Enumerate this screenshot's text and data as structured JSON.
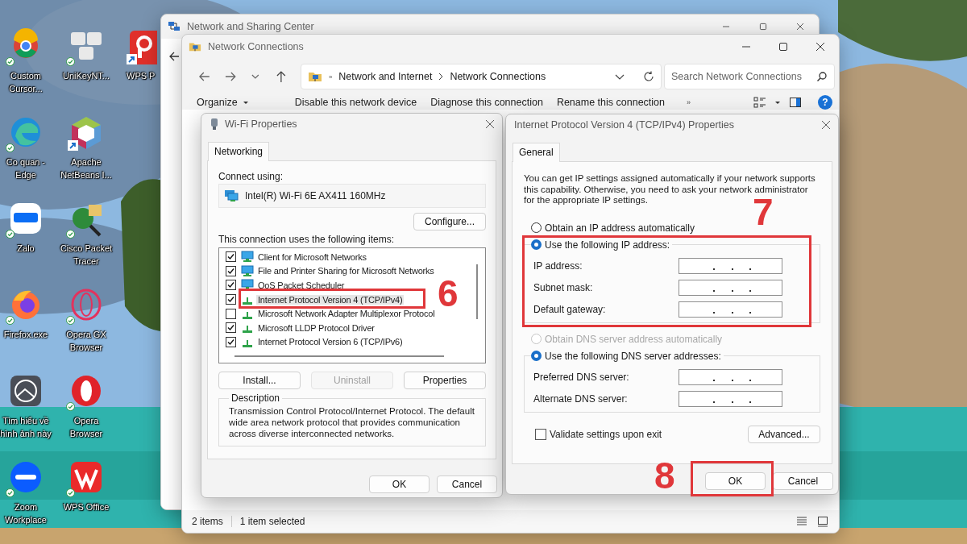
{
  "desktop": {
    "columns": [
      [
        {
          "label": "Custom Cursor...",
          "synced": true,
          "shortcut": false
        },
        {
          "label": "Co quan - Edge",
          "synced": true,
          "shortcut": false
        },
        {
          "label": "Zalo",
          "synced": true,
          "shortcut": false
        },
        {
          "label": "Firefox.exe",
          "synced": true,
          "shortcut": false
        },
        {
          "label": "Tìm hiểu về hình ảnh này",
          "synced": false,
          "shortcut": false
        },
        {
          "label": "Zoom Workplace",
          "synced": true,
          "shortcut": false
        }
      ],
      [
        {
          "label": "UniKeyNT...",
          "synced": true,
          "shortcut": false
        },
        {
          "label": "Apache NetBeans I...",
          "synced": false,
          "shortcut": true
        },
        {
          "label": "Cisco Packet Tracer",
          "synced": true,
          "shortcut": false
        },
        {
          "label": "Opera GX Browser",
          "synced": true,
          "shortcut": false
        },
        {
          "label": "Opera Browser",
          "synced": true,
          "shortcut": false
        },
        {
          "label": "WPS Office",
          "synced": true,
          "shortcut": false
        }
      ],
      [
        {
          "label": "WPS P",
          "synced": false,
          "shortcut": true
        }
      ]
    ]
  },
  "sharing_center": {
    "title": "Network and Sharing Center"
  },
  "connections": {
    "title": "Network Connections",
    "address": {
      "overflow": "»",
      "segments": [
        "Network and Internet",
        "Network Connections"
      ]
    },
    "search": {
      "placeholder": "Search Network Connections"
    },
    "toolbar": [
      "Organize",
      "Disable this network device",
      "Diagnose this connection",
      "Rename this connection"
    ],
    "toolbar_overflow": "»",
    "help": "?",
    "status_bar": [
      "2 items",
      "1 item selected"
    ]
  },
  "wifi_dialog": {
    "title": "Wi-Fi Properties",
    "tabs": [
      {
        "label": "Networking",
        "selected": true
      }
    ],
    "connect_label": "Connect using:",
    "adapter": "Intel(R) Wi-Fi 6E AX411 160MHz",
    "configure": "Configure...",
    "items_label": "This connection uses the following items:",
    "items": [
      {
        "label": "Client for Microsoft Networks",
        "kind": "service",
        "checked": true,
        "selected": false
      },
      {
        "label": "File and Printer Sharing for Microsoft Networks",
        "kind": "service",
        "checked": true,
        "selected": false
      },
      {
        "label": "QoS Packet Scheduler",
        "kind": "service",
        "checked": true,
        "selected": false
      },
      {
        "label": "Internet Protocol Version 4 (TCP/IPv4)",
        "kind": "protocol",
        "checked": true,
        "selected": true
      },
      {
        "label": "Microsoft Network Adapter Multiplexor Protocol",
        "kind": "protocol",
        "checked": false,
        "selected": false
      },
      {
        "label": "Microsoft LLDP Protocol Driver",
        "kind": "protocol",
        "checked": true,
        "selected": false
      },
      {
        "label": "Internet Protocol Version 6 (TCP/IPv6)",
        "kind": "protocol",
        "checked": true,
        "selected": false
      }
    ],
    "buttons": [
      {
        "label": "Install...",
        "disabled": false
      },
      {
        "label": "Uninstall",
        "disabled": true
      },
      {
        "label": "Properties",
        "disabled": false
      }
    ],
    "description": {
      "legend": "Description",
      "text": "Transmission Control Protocol/Internet Protocol. The default wide area network protocol that provides communication across diverse interconnected networks."
    },
    "footer": [
      "OK",
      "Cancel"
    ]
  },
  "ipv4_dialog": {
    "title": "Internet Protocol Version 4 (TCP/IPv4) Properties",
    "tabs": [
      {
        "label": "General",
        "selected": true
      }
    ],
    "intro": "You can get IP settings assigned automatically if your network supports this capability. Otherwise, you need to ask your network administrator for the appropriate IP settings.",
    "ip": {
      "auto": {
        "label": "Obtain an IP address automatically",
        "selected": false,
        "disabled": false
      },
      "manual": {
        "label": "Use the following IP address:",
        "selected": true,
        "disabled": false
      },
      "fields": [
        "IP address:",
        "Subnet mask:",
        "Default gateway:"
      ]
    },
    "dns": {
      "auto": {
        "label": "Obtain DNS server address automatically",
        "selected": false,
        "disabled": true
      },
      "manual": {
        "label": "Use the following DNS server addresses:",
        "selected": true,
        "disabled": false
      },
      "fields": [
        "Preferred DNS server:",
        "Alternate DNS server:"
      ]
    },
    "validate": {
      "label": "Validate settings upon exit",
      "checked": false
    },
    "advanced": "Advanced...",
    "footer": [
      "OK",
      "Cancel"
    ]
  },
  "annotations": [
    {
      "label": "6"
    },
    {
      "label": "7"
    },
    {
      "label": "8"
    }
  ]
}
